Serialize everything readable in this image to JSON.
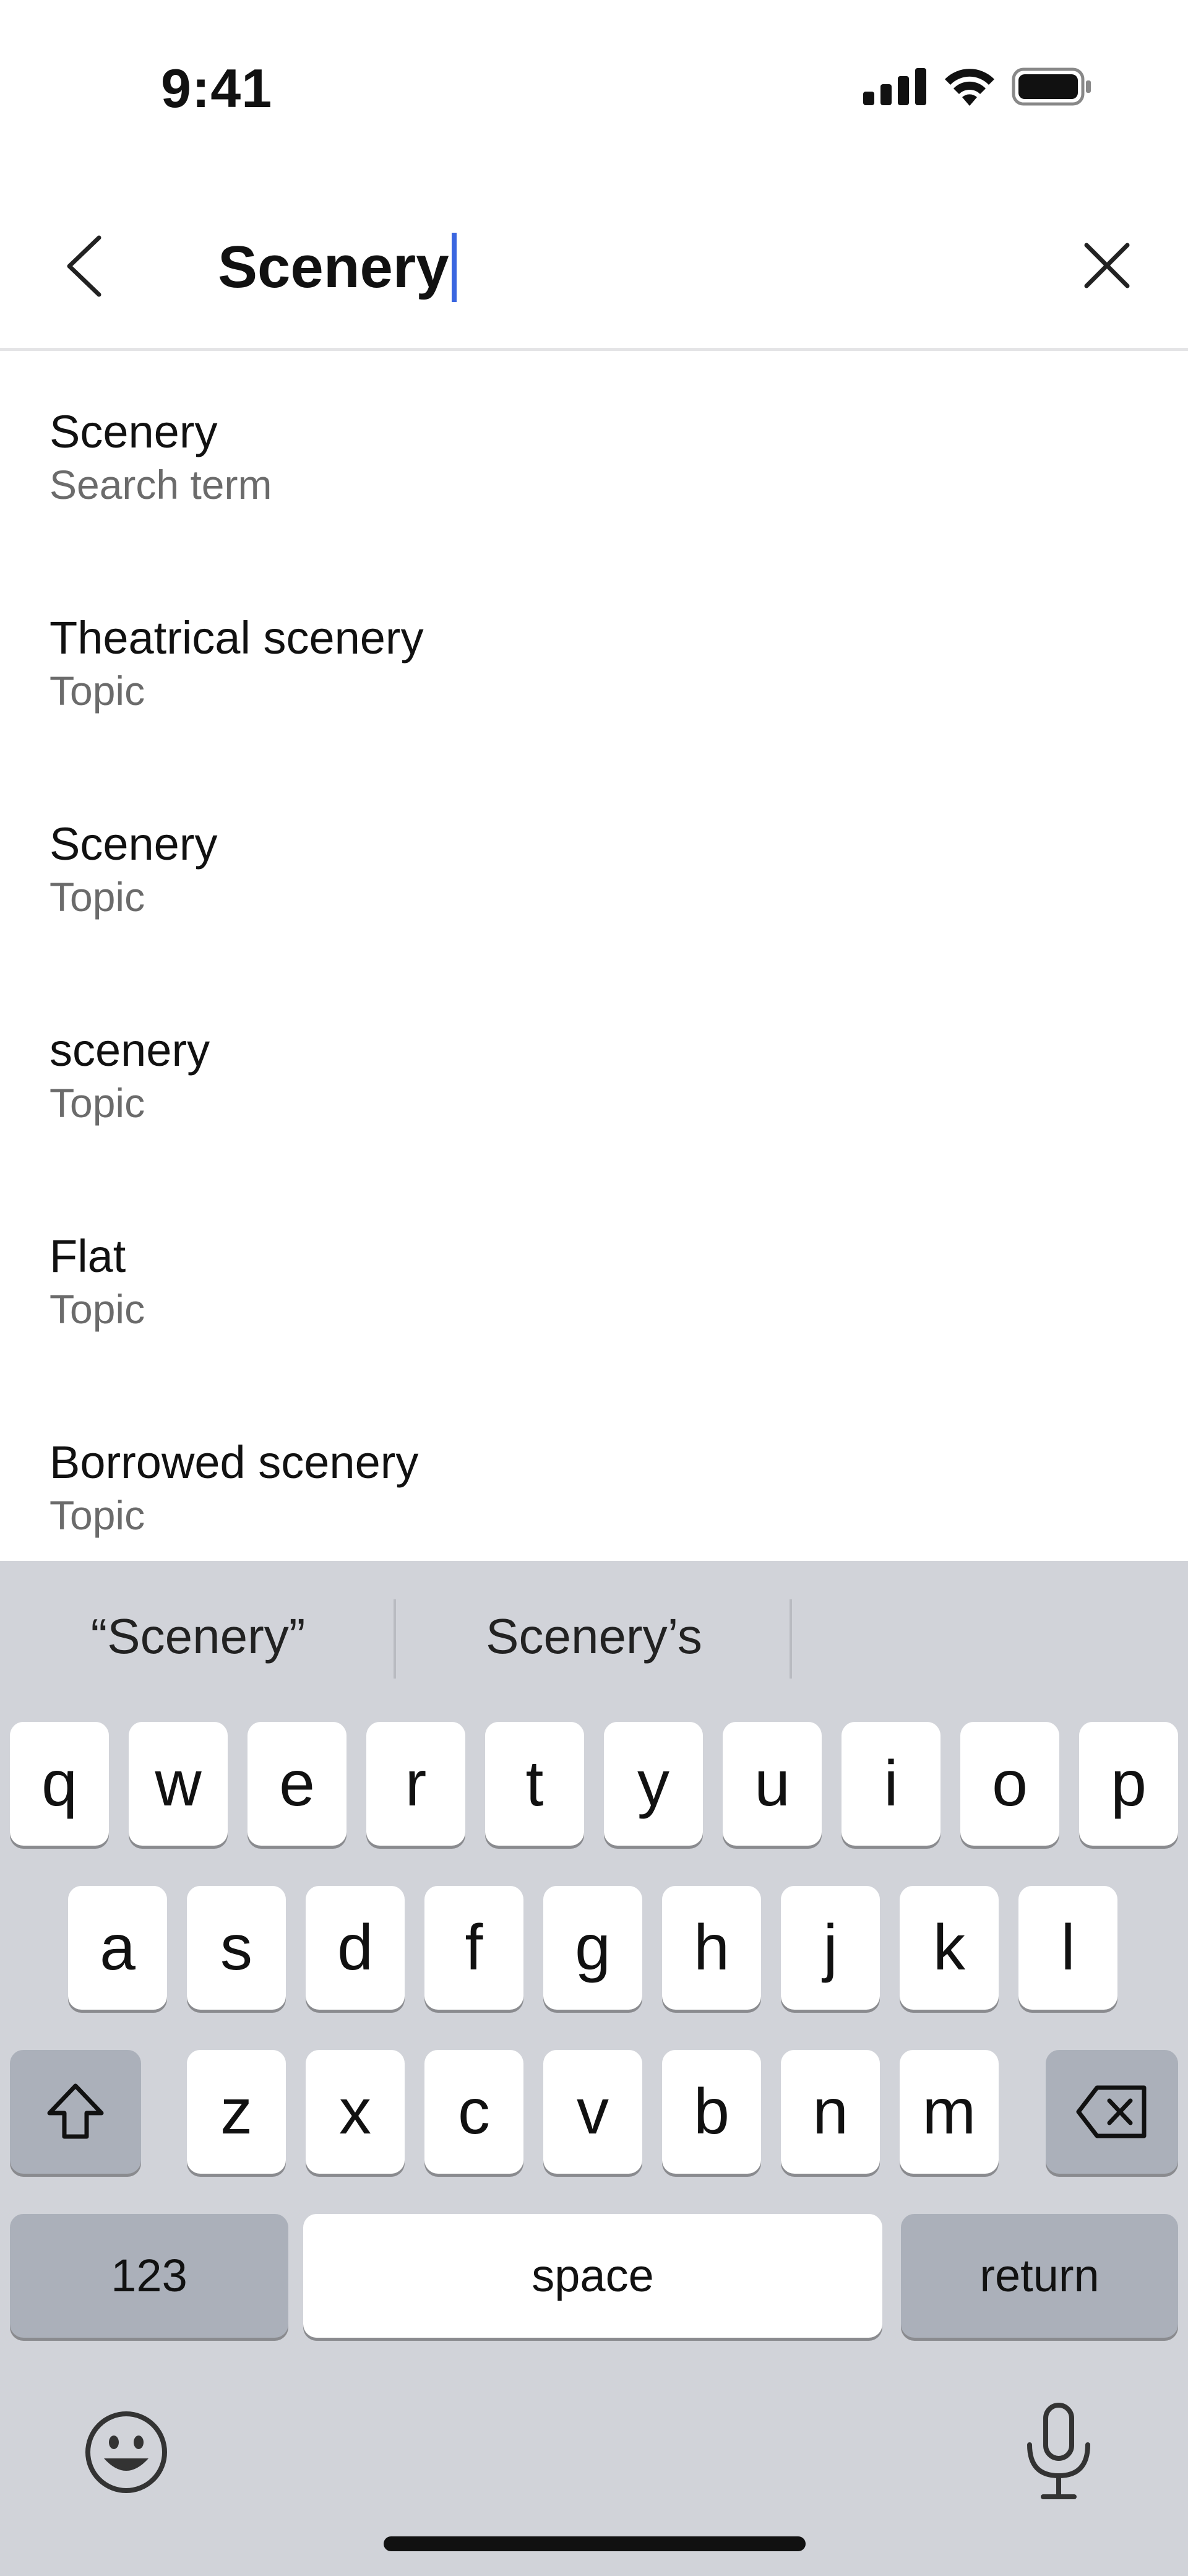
{
  "status_bar": {
    "time": "9:41"
  },
  "search": {
    "query": "Scenery"
  },
  "results": [
    {
      "title": "Scenery",
      "subtitle": "Search term"
    },
    {
      "title": "Theatrical scenery",
      "subtitle": "Topic"
    },
    {
      "title": "Scenery",
      "subtitle": "Topic"
    },
    {
      "title": "scenery",
      "subtitle": "Topic"
    },
    {
      "title": "Flat",
      "subtitle": "Topic"
    },
    {
      "title": "Borrowed scenery",
      "subtitle": "Topic"
    }
  ],
  "keyboard": {
    "suggestions": [
      "“Scenery”",
      "Scenery’s"
    ],
    "row1": [
      "q",
      "w",
      "e",
      "r",
      "t",
      "y",
      "u",
      "i",
      "o",
      "p"
    ],
    "row2": [
      "a",
      "s",
      "d",
      "f",
      "g",
      "h",
      "j",
      "k",
      "l"
    ],
    "row3": [
      "z",
      "x",
      "c",
      "v",
      "b",
      "n",
      "m"
    ],
    "numbers_label": "123",
    "space_label": "space",
    "return_label": "return"
  },
  "colors": {
    "caret": "#3a66e0",
    "keyboard_bg": "#d1d3d9",
    "key_dark": "#abb0ba"
  }
}
